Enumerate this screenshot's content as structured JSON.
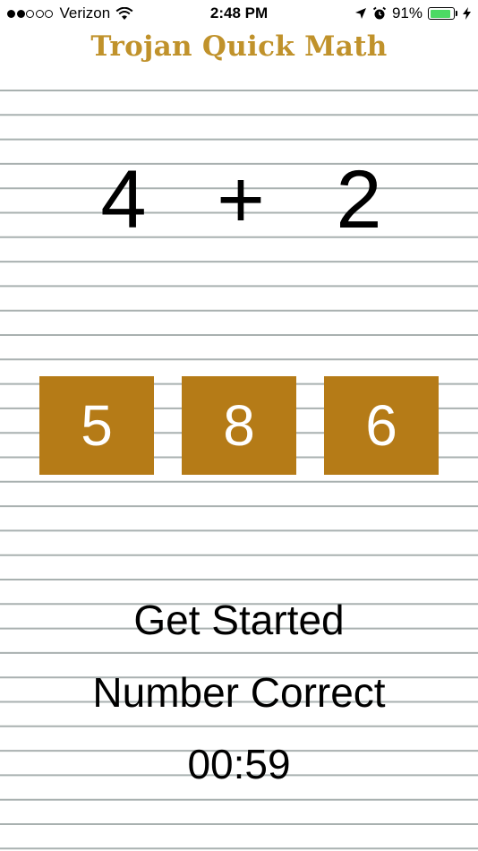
{
  "status_bar": {
    "carrier": "Verizon",
    "time": "2:48 PM",
    "battery_percent": "91%",
    "battery_level": 0.91,
    "signal_strength": 2,
    "signal_total": 5,
    "battery_color": "#4cd964"
  },
  "app": {
    "title": "Trojan Quick Math",
    "title_color": "#c0922b"
  },
  "problem": {
    "operand_a": "4",
    "operator": "+",
    "operand_b": "2"
  },
  "answers": {
    "option_1": "5",
    "option_2": "8",
    "option_3": "6",
    "button_color": "#b57b17"
  },
  "controls": {
    "get_started_label": "Get Started",
    "number_correct_label": "Number Correct",
    "timer": "00:59"
  }
}
